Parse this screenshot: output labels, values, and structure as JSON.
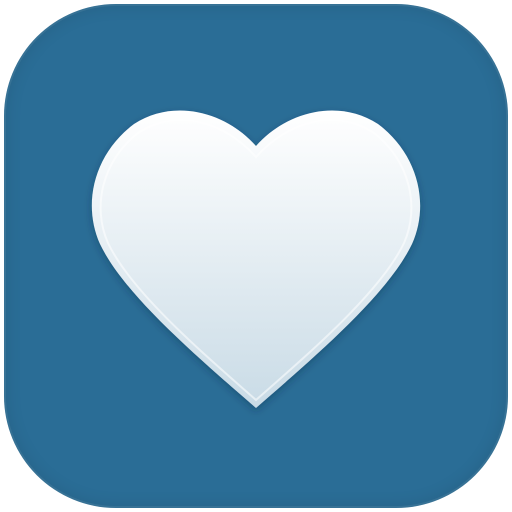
{
  "app_icon": {
    "icon": "heart-icon",
    "background_color": "#2a6d96",
    "glyph_color_top": "#ffffff",
    "glyph_color_bottom": "#c9dbe6"
  }
}
